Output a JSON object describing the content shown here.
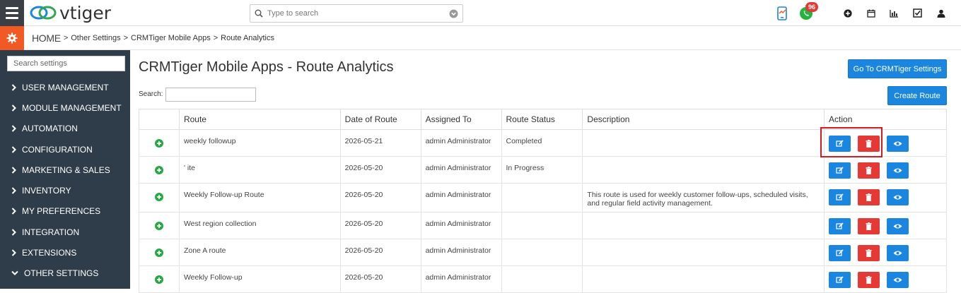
{
  "topbar": {
    "logo_text": "vtiger",
    "search_placeholder": "Type to search",
    "notification_count": "96"
  },
  "breadcrumb": {
    "home": "HOME",
    "items": [
      "Other Settings",
      "CRMTiger Mobile Apps",
      "Route Analytics"
    ],
    "separator": ">"
  },
  "sidebar": {
    "search_placeholder": "Search settings",
    "items": [
      {
        "label": "USER MANAGEMENT",
        "expanded": false
      },
      {
        "label": "MODULE MANAGEMENT",
        "expanded": false
      },
      {
        "label": "AUTOMATION",
        "expanded": false
      },
      {
        "label": "CONFIGURATION",
        "expanded": false
      },
      {
        "label": "MARKETING & SALES",
        "expanded": false
      },
      {
        "label": "INVENTORY",
        "expanded": false
      },
      {
        "label": "MY PREFERENCES",
        "expanded": false
      },
      {
        "label": "INTEGRATION",
        "expanded": false
      },
      {
        "label": "EXTENSIONS",
        "expanded": false
      },
      {
        "label": "OTHER SETTINGS",
        "expanded": true
      }
    ]
  },
  "main": {
    "title": "CRMTiger Mobile Apps - Route Analytics",
    "goto_button": "Go To CRMTiger Settings",
    "create_button": "Create Route",
    "search_label": "Search:",
    "search_value": "",
    "columns": [
      "Route",
      "Date of Route",
      "Assigned To",
      "Route Status",
      "Description",
      "Action"
    ],
    "rows": [
      {
        "route": "weekly followup",
        "date": "2026-05-21",
        "assigned": "admin Administrator",
        "status": "Completed",
        "description": ""
      },
      {
        "route": "'           ite",
        "date": "2026-05-20",
        "assigned": "admin Administrator",
        "status": "In Progress",
        "description": ""
      },
      {
        "route": "Weekly Follow-up Route",
        "date": "2026-05-20",
        "assigned": "admin Administrator",
        "status": "",
        "description": "This route is used for weekly customer follow-ups, scheduled visits, and regular field activity management."
      },
      {
        "route": "West region collection",
        "date": "2026-05-20",
        "assigned": "admin Administrator",
        "status": "",
        "description": ""
      },
      {
        "route": "Zone A route",
        "date": "2026-05-20",
        "assigned": "admin Administrator",
        "status": "",
        "description": ""
      },
      {
        "route": "Weekly Follow-up",
        "date": "2026-05-20",
        "assigned": "admin Administrator",
        "status": "",
        "description": ""
      }
    ]
  },
  "colors": {
    "sidebar_bg": "#2f3d4a",
    "accent_orange": "#f15a24",
    "button_blue": "#1a86e0",
    "delete_red": "#e53935",
    "add_green": "#27a844",
    "highlight_red": "#d71920"
  }
}
